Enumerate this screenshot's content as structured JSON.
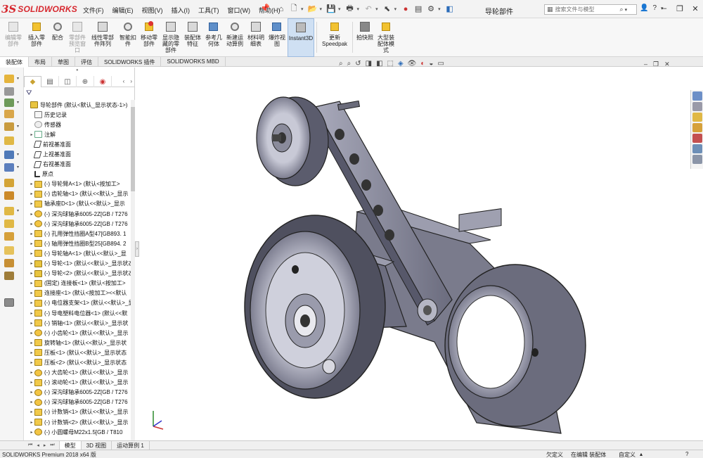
{
  "app": {
    "logo_ds": "3S",
    "logo_text": "SOLIDWORKS",
    "document_title": "导轮部件"
  },
  "menu": [
    "文件(F)",
    "编辑(E)",
    "视图(V)",
    "插入(I)",
    "工具(T)",
    "窗口(W)",
    "帮助(H)"
  ],
  "search": {
    "placeholder": "搜索文件与模型"
  },
  "ribbon": [
    {
      "label": "编辑零\n部件",
      "dim": true
    },
    {
      "label": "插入零\n部件"
    },
    {
      "label": "配合"
    },
    {
      "label": "零部件\n预览窗\n口",
      "dim": true
    },
    {
      "label": "线性零部\n件阵列"
    },
    {
      "label": "智能扣\n件"
    },
    {
      "label": "移动零\n部件"
    },
    {
      "label": "显示隐\n藏的零\n部件"
    },
    {
      "label": "装配体\n特征"
    },
    {
      "label": "参考几\n何体"
    },
    {
      "label": "新建运\n动算例"
    },
    {
      "label": "材料明\n细表"
    },
    {
      "label": "爆炸视\n图"
    },
    {
      "label": "Instant3D",
      "active": true
    },
    {
      "label": "更新\nSpeedpak"
    },
    {
      "label": "拍快照"
    },
    {
      "label": "大型装\n配体模\n式"
    }
  ],
  "tabs": [
    "装配体",
    "布局",
    "草图",
    "评估",
    "SOLIDWORKS 插件",
    "SOLIDWORKS MBD"
  ],
  "tree": [
    {
      "label": "导轮部件  (默认<默认_显示状态-1>)",
      "icon": "asm",
      "indent": 0,
      "expand": ""
    },
    {
      "label": "历史记录",
      "icon": "hist",
      "indent": 1,
      "expand": ""
    },
    {
      "label": "传感器",
      "icon": "sens",
      "indent": 1,
      "expand": ""
    },
    {
      "label": "注解",
      "icon": "note",
      "indent": 1,
      "expand": "▸"
    },
    {
      "label": "前视基准面",
      "icon": "plane",
      "indent": 1,
      "expand": ""
    },
    {
      "label": "上视基准面",
      "icon": "plane",
      "indent": 1,
      "expand": ""
    },
    {
      "label": "右视基准面",
      "icon": "plane",
      "indent": 1,
      "expand": ""
    },
    {
      "label": "原点",
      "icon": "origin",
      "indent": 1,
      "expand": ""
    },
    {
      "label": "(-) 导轮臂A<1> (默认<按加工>",
      "icon": "part",
      "indent": 1,
      "expand": "▸"
    },
    {
      "label": "(-) 齿轮轴<1> (默认<<默认>_显示",
      "icon": "part",
      "indent": 1,
      "expand": "▸"
    },
    {
      "label": "轴承座D<1> (默认<<默认>_显示",
      "icon": "part",
      "indent": 1,
      "expand": "▸"
    },
    {
      "label": "(-) 深沟球轴承6005-2Z[GB / T276",
      "icon": "gear",
      "indent": 1,
      "expand": "▸"
    },
    {
      "label": "(-) 深沟球轴承6005-2Z[GB / T276",
      "icon": "gear",
      "indent": 1,
      "expand": "▸"
    },
    {
      "label": "(-) 孔用弹性挡圈A型47[GB893.  1",
      "icon": "part",
      "indent": 1,
      "expand": "▸"
    },
    {
      "label": "(-) 轴用弹性挡圈B型25[GB894.  2",
      "icon": "part",
      "indent": 1,
      "expand": "▸"
    },
    {
      "label": "(-) 导轮轴A<1> (默认<<默认>_显",
      "icon": "part",
      "indent": 1,
      "expand": "▸"
    },
    {
      "label": "(-) 导轮<1> (默认<<默认>_显示状态",
      "icon": "asm",
      "indent": 1,
      "expand": "▸"
    },
    {
      "label": "(-) 导轮<2> (默认<<默认>_显示状态",
      "icon": "asm",
      "indent": 1,
      "expand": "▸"
    },
    {
      "label": "(固定) 连接板<1> (默认<按加工>",
      "icon": "part",
      "indent": 1,
      "expand": "▸"
    },
    {
      "label": "连接座<1> (默认<按加工><<默认",
      "icon": "part",
      "indent": 1,
      "expand": "▸"
    },
    {
      "label": "(-) 电位器支架<1> (默认<<默认>_显",
      "icon": "part",
      "indent": 1,
      "expand": "▸"
    },
    {
      "label": "(-) 导电塑料电位器<1> (默认<<默",
      "icon": "part",
      "indent": 1,
      "expand": "▸"
    },
    {
      "label": "(-) 销轴<1> (默认<<默认>_显示状",
      "icon": "part",
      "indent": 1,
      "expand": "▸"
    },
    {
      "label": "(-) 小齿轮<1> (默认<<默认>_显示",
      "icon": "gear",
      "indent": 1,
      "expand": "▸"
    },
    {
      "label": "旋转轴<1> (默认<<默认>_显示状",
      "icon": "part",
      "indent": 1,
      "expand": "▸"
    },
    {
      "label": "压板<1> (默认<<默认>_显示状态",
      "icon": "part",
      "indent": 1,
      "expand": "▸"
    },
    {
      "label": "压板<2> (默认<<默认>_显示状态",
      "icon": "part",
      "indent": 1,
      "expand": "▸"
    },
    {
      "label": "(-) 大齿轮<1> (默认<<默认>_显示",
      "icon": "gear",
      "indent": 1,
      "expand": "▸"
    },
    {
      "label": "(-) 滚动轮<1> (默认<<默认>_显示",
      "icon": "part",
      "indent": 1,
      "expand": "▸"
    },
    {
      "label": "(-) 深沟球轴承6005-2Z[GB / T276",
      "icon": "gear",
      "indent": 1,
      "expand": "▸"
    },
    {
      "label": "(-) 深沟球轴承6005-2Z[GB / T276",
      "icon": "gear",
      "indent": 1,
      "expand": "▸"
    },
    {
      "label": "(-) 计数销<1> (默认<<默认>_显示",
      "icon": "part",
      "indent": 1,
      "expand": "▸"
    },
    {
      "label": "(-) 计数销<2> (默认<<默认>_显示",
      "icon": "part",
      "indent": 1,
      "expand": "▸"
    },
    {
      "label": "(-) 小圆螺母M22x1.5[GB / T810",
      "icon": "gear",
      "indent": 1,
      "expand": "▸"
    }
  ],
  "bottom_tabs": [
    "模型",
    "3D 视图",
    "运动算例 1"
  ],
  "status": {
    "product": "SOLIDWORKS Premium 2018 x64 版",
    "constraint": "欠定义",
    "editing": "在编辑 装配体",
    "units": "自定义"
  }
}
